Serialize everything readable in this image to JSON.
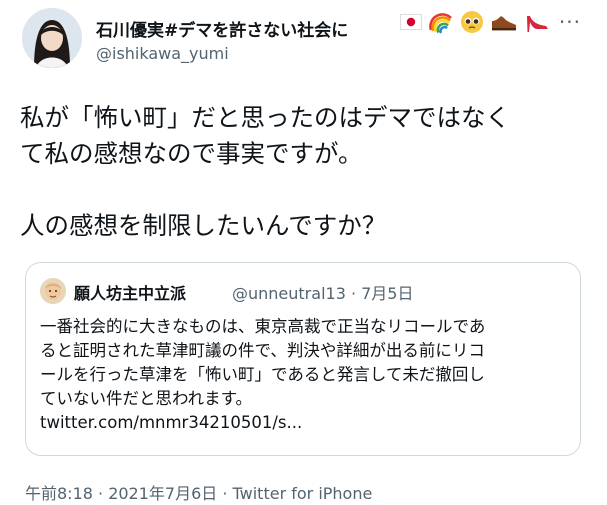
{
  "author": {
    "display_name": "石川優実#デマを許さない社会に",
    "handle": "@ishikawa_yumi",
    "emoji_icons": [
      "japan-flag-icon",
      "rainbow-icon",
      "pleading-face-icon",
      "mens-shoe-icon",
      "high-heel-icon"
    ]
  },
  "more_label": "···",
  "tweet": {
    "lines": [
      "私が「怖い町」だと思ったのはデマではなく",
      "て私の感想なので事実ですが。",
      "人の感想を制限したいんですか？"
    ]
  },
  "quoted": {
    "display_name": "願人坊主中立派",
    "handle_date": "@unneutral13 · 7月5日",
    "lines": [
      "一番社会的に大きなものは、東京高裁で正当なリコールであ",
      "ると証明された草津町議の件で、判決や詳細が出る前にリコ",
      "ールを行った草津を「怖い町」であると発言して未だ撤回し",
      "ていない件だと思われます。",
      "twitter.com/mnmr34210501/s..."
    ]
  },
  "meta": "午前8:18 · 2021年7月6日 · Twitter for iPhone"
}
